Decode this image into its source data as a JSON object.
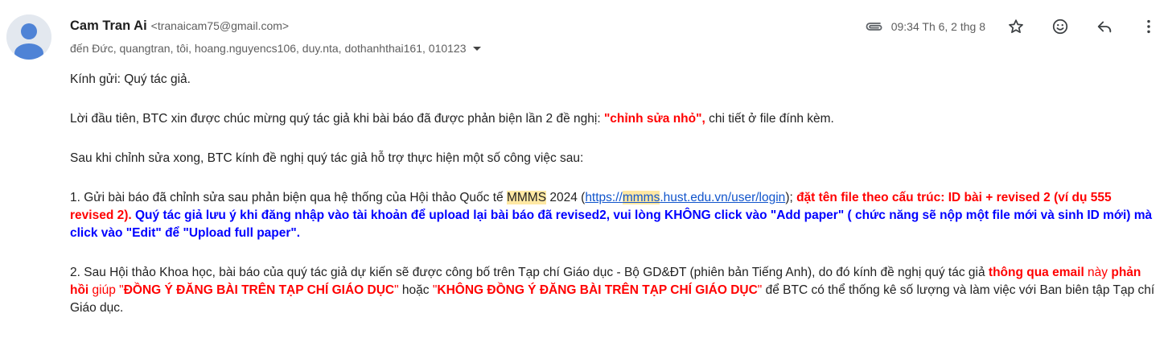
{
  "sender": {
    "name": "Cam Tran Ai",
    "email": "<tranaicam75@gmail.com>",
    "recipients": "đến Đức, quangtran, tôi, hoang.nguyencs106, duy.nta, dothanhthai161, 010123"
  },
  "meta": {
    "timestamp": "09:34 Th 6, 2 thg 8"
  },
  "icons": {
    "attachment": "attachment-icon",
    "star": "star-icon",
    "emoji": "emoji-icon",
    "reply": "reply-icon",
    "more": "more-vert-icon",
    "avatar": "avatar-icon"
  },
  "colors": {
    "red": "#ff0000",
    "blue": "#0000ff",
    "link": "#1155cc",
    "highlight": "#ffe8a3"
  },
  "body": {
    "greeting": "Kính gửi: Quý tác giả.",
    "p1": {
      "a": "Lời đầu tiên, BTC xin được chúc mừng quý tác giả khi bài báo đã được phản biện lần 2 đề nghị: ",
      "b": "\"chỉnh sửa nhỏ\",",
      "c": " chi tiết ở file đính kèm."
    },
    "p2": "Sau khi chỉnh sửa xong, BTC kính đề nghị quý tác giả hỗ trợ thực hiện một số công việc sau:",
    "p3": {
      "a": "1. Gửi bài báo đã chỉnh sửa sau phản biện qua hệ thống của Hội thảo Quốc tế ",
      "mmms": "MMMS",
      "b": " 2024 (",
      "link1": "https://",
      "link2": "mmms",
      "link3": ".hust.edu.vn/user/login",
      "c": "); ",
      "red": "đặt tên file theo cấu trúc: ID bài + revised 2 (ví dụ 555 revised 2).",
      "blue": " Quý tác giả lưu ý khi đăng nhập vào tài khoản để upload lại bài báo đã revised2, vui lòng KHÔNG click vào \"Add paper\" ( chức năng sẽ nộp một file mới và sinh ID mới) mà click vào \"Edit\" để \"Upload full paper\"."
    },
    "p4": {
      "a": "2. Sau Hội thảo Khoa học, bài báo của quý tác giả dự kiến sẽ được công bố trên Tạp chí Giáo dục - Bộ GD&ĐT (phiên bản Tiếng Anh), do đó kính đề nghị quý tác giả ",
      "b": "thông qua email",
      "c": " này ",
      "d": "phản hồi",
      "e": " giúp ",
      "f": "\"",
      "g": "ĐỒNG Ý ĐĂNG BÀI TRÊN TẠP CHÍ GIÁO DỤC",
      "h": "\"",
      "i": " hoặc ",
      "j": "\"",
      "k": "KHÔNG ĐỒNG Ý ĐĂNG BÀI TRÊN TẠP CHÍ GIÁO DỤC",
      "l": "\"",
      "m": " để BTC có thể thống kê số lượng và làm việc với Ban biên tập Tạp chí Giáo dục."
    }
  }
}
